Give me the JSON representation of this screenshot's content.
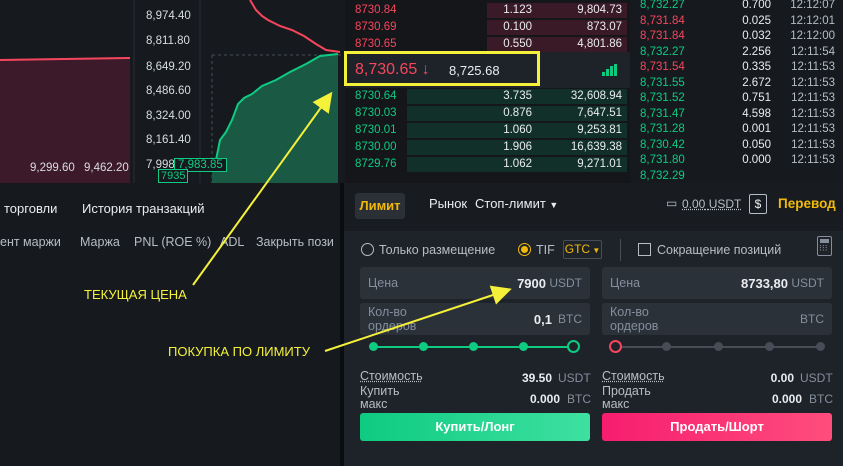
{
  "depth_chart": {
    "y_labels": [
      "8,974.40",
      "8,811.80",
      "8,649.20",
      "8,486.60",
      "8,324.00",
      "8,161.40",
      "7,998.80"
    ],
    "x_labels": [
      "9,299.60",
      "9,462.20"
    ],
    "hover_price": "7,983.85",
    "hover_amount": "7935"
  },
  "order_book": {
    "asks": [
      {
        "price": "8730.84",
        "qty": "1.123",
        "total": "9,804.73"
      },
      {
        "price": "8730.69",
        "qty": "0.100",
        "total": "873.07"
      },
      {
        "price": "8730.65",
        "qty": "0.550",
        "total": "4,801.86"
      }
    ],
    "last_price": "8,730.65",
    "last_arrow": "↓",
    "mark_price": "8,725.68",
    "bids": [
      {
        "price": "8730.64",
        "qty": "3.735",
        "total": "32,608.94"
      },
      {
        "price": "8730.03",
        "qty": "0.876",
        "total": "7,647.51"
      },
      {
        "price": "8730.01",
        "qty": "1.060",
        "total": "9,253.81"
      },
      {
        "price": "8730.00",
        "qty": "1.906",
        "total": "16,639.38"
      },
      {
        "price": "8729.76",
        "qty": "1.062",
        "total": "9,271.01"
      }
    ]
  },
  "trades": [
    {
      "price": "8,732.27",
      "qty": "0.700",
      "time": "12:12:07",
      "side": "up"
    },
    {
      "price": "8,731.84",
      "qty": "0.025",
      "time": "12:12:01",
      "side": "dn"
    },
    {
      "price": "8,731.84",
      "qty": "0.032",
      "time": "12:12:00",
      "side": "dn"
    },
    {
      "price": "8,732.27",
      "qty": "2.256",
      "time": "12:11:54",
      "side": "up"
    },
    {
      "price": "8,731.54",
      "qty": "0.335",
      "time": "12:11:53",
      "side": "dn"
    },
    {
      "price": "8,731.55",
      "qty": "2.672",
      "time": "12:11:53",
      "side": "up"
    },
    {
      "price": "8,731.52",
      "qty": "0.751",
      "time": "12:11:53",
      "side": "up"
    },
    {
      "price": "8,731.47",
      "qty": "4.598",
      "time": "12:11:53",
      "side": "up"
    },
    {
      "price": "8,731.28",
      "qty": "0.001",
      "time": "12:11:53",
      "side": "up"
    },
    {
      "price": "8,730.42",
      "qty": "0.050",
      "time": "12:11:53",
      "side": "up"
    },
    {
      "price": "8,731.80",
      "qty": "0.000",
      "time": "12:11:53",
      "side": "up"
    },
    {
      "price": "8,732.29",
      "qty": "",
      "time": "",
      "side": "up"
    }
  ],
  "left_panel": {
    "tabs": [
      "торговли",
      "История транзакций"
    ],
    "columns": [
      "ент маржи",
      "Маржа",
      "PNL (ROE %)",
      "ADL",
      "Закрыть пози"
    ]
  },
  "order_form": {
    "tabs": {
      "limit": "Лимит",
      "market": "Рынок",
      "stop_limit": "Стоп-лимит"
    },
    "balance": "0.00",
    "balance_unit": "USDT",
    "dollar_icon": "$",
    "transfer": "Перевод",
    "options": {
      "post_only": "Только размещение",
      "tif": "TIF",
      "gtc": "GTC",
      "reduce_only": "Сокращение позиций"
    },
    "buy": {
      "price_label": "Цена",
      "price": "7900",
      "price_unit": "USDT",
      "qty_label": "Кол-во ордеров",
      "qty": "0,1",
      "qty_unit": "BTC",
      "cost_label": "Стоимость",
      "cost": "39.50",
      "cost_unit": "USDT",
      "max_label": "Купить макс",
      "max": "0.000",
      "max_unit": "BTC",
      "button": "Купить/Лонг",
      "slider_fraction": 1.0
    },
    "sell": {
      "price_label": "Цена",
      "price": "8733,80",
      "price_unit": "USDT",
      "qty_label": "Кол-во ордеров",
      "qty": "",
      "qty_unit": "BTC",
      "cost_label": "Стоимость",
      "cost": "0.00",
      "cost_unit": "USDT",
      "max_label": "Продать макс",
      "max": "0.000",
      "max_unit": "BTC",
      "button": "Продать/Шорт",
      "slider_fraction": 0.0
    }
  },
  "annotations": {
    "current_price": "ТЕКУЩАЯ ЦЕНА",
    "limit_buy": "ПОКУПКА ПО ЛИМИТУ"
  },
  "colors": {
    "accent": "#f0b90b",
    "buy": "#0ecb81",
    "sell": "#f6465d",
    "highlight": "#f5f13a"
  }
}
